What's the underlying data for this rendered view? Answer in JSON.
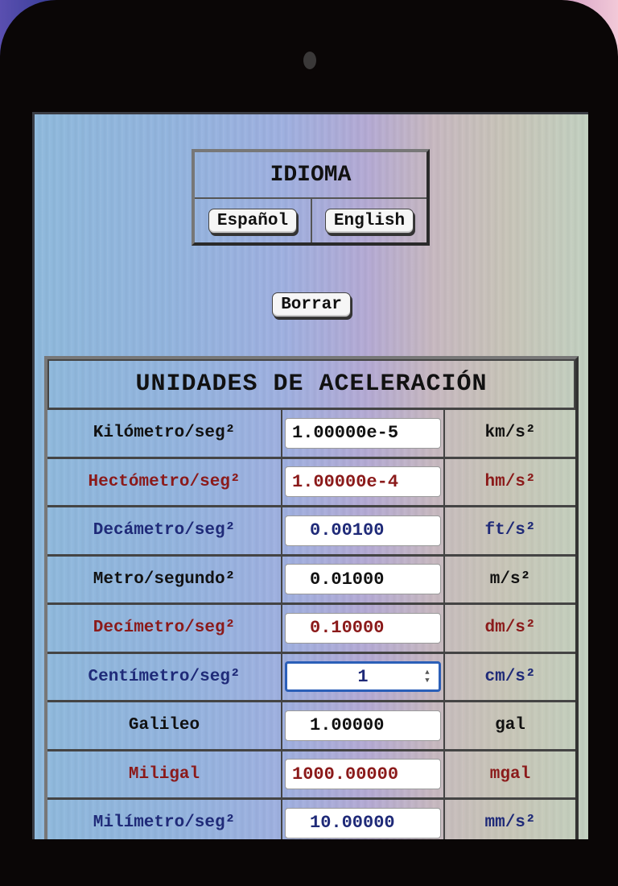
{
  "language_panel": {
    "title": "IDIOMA",
    "spanish_label": "Español",
    "english_label": "English"
  },
  "clear_button_label": "Borrar",
  "converter": {
    "title": "UNIDADES DE ACELERACIÓN",
    "colors": {
      "black": "#111111",
      "red": "#8b1a1a",
      "blue": "#1f2a78"
    },
    "rows": [
      {
        "label": "Kilómetro/seg²",
        "value": "1.00000e-5",
        "unit": "km/s²",
        "color": "#111111",
        "align": "left"
      },
      {
        "label": "Hectómetro/seg²",
        "value": "1.00000e-4",
        "unit": "hm/s²",
        "color": "#8b1a1a",
        "align": "left"
      },
      {
        "label": "Decámetro/seg²",
        "value": "0.00100",
        "unit": "ft/s²",
        "color": "#1f2a78",
        "align": "indent"
      },
      {
        "label": "Metro/segundo²",
        "value": "0.01000",
        "unit": "m/s²",
        "color": "#111111",
        "align": "indent"
      },
      {
        "label": "Decímetro/seg²",
        "value": "0.10000",
        "unit": "dm/s²",
        "color": "#8b1a1a",
        "align": "indent"
      },
      {
        "label": "Centímetro/seg²",
        "value": "1",
        "unit": "cm/s²",
        "color": "#1f2a78",
        "align": "center",
        "focused": true
      },
      {
        "label": "Galileo",
        "value": "1.00000",
        "unit": "gal",
        "color": "#111111",
        "align": "indent"
      },
      {
        "label": "Miligal",
        "value": "1000.00000",
        "unit": "mgal",
        "color": "#8b1a1a",
        "align": "left"
      },
      {
        "label": "Milímetro/seg²",
        "value": "10.00000",
        "unit": "mm/s²",
        "color": "#1f2a78",
        "align": "indent"
      }
    ]
  }
}
